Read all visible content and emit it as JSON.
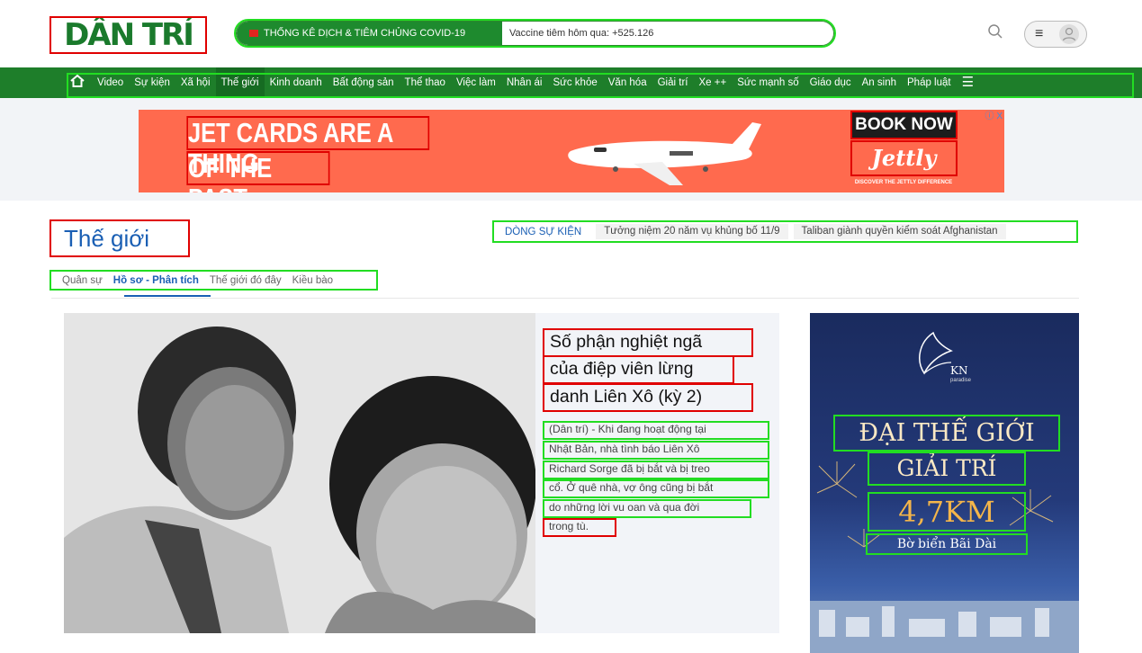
{
  "header": {
    "logo_text": "DÂN TRÍ",
    "covid_label": "THỐNG KÊ DỊCH & TIÊM CHỦNG COVID-19",
    "covid_stat": "Vaccine tiêm hôm qua: +525.126",
    "search_icon": "search-icon",
    "menu_icon": "hamburger-icon",
    "user_icon": "user-icon"
  },
  "nav": {
    "home_icon": "home-icon",
    "items": [
      "Video",
      "Sự kiện",
      "Xã hội",
      "Thế giới",
      "Kinh doanh",
      "Bất động sản",
      "Thể thao",
      "Việc làm",
      "Nhân ái",
      "Sức khỏe",
      "Văn hóa",
      "Giải trí",
      "Xe ++",
      "Sức mạnh số",
      "Giáo dục",
      "An sinh",
      "Pháp luật"
    ],
    "active": "Thế giới",
    "more_icon": "menu-icon"
  },
  "ad_banner": {
    "line1": "JET CARDS ARE A THING",
    "line2": "OF THE PAST",
    "cta": "BOOK NOW",
    "brand": "Jettly",
    "tagline": "DISCOVER THE JETTLY DIFFERENCE",
    "adchoices": "ⓘ X"
  },
  "section": {
    "title": "Thế giới",
    "events_label": "DÒNG SỰ KIỆN",
    "events": [
      "Tưởng niệm 20 năm vụ khủng bố 11/9",
      "Taliban giành quyền kiểm soát Afghanistan"
    ],
    "subnav": [
      "Quân sự",
      "Hồ sơ - Phân tích",
      "Thế giới đó đây",
      "Kiều bào"
    ],
    "subnav_active": "Hồ sơ - Phân tích"
  },
  "featured": {
    "title_lines": [
      "Số phận nghiệt ngã",
      "của điệp viên lừng",
      "danh Liên Xô (kỳ 2)"
    ],
    "summary_lines": [
      "(Dân trí) - Khi đang hoạt động tại",
      "Nhật Bản, nhà tình báo Liên Xô",
      "Richard Sorge đã bị bắt và bị treo",
      "cổ. Ở quê nhà, vợ ông cũng bị bắt",
      "do những lời vu oan và qua đời",
      "trong tù."
    ]
  },
  "side_ad": {
    "brand": "KN",
    "brand_sub": "paradise",
    "line1": "ĐẠI THẾ GIỚI",
    "line2": "GIẢI TRÍ",
    "line3": "4,7KM",
    "line4": "Bờ biển Bãi Dài"
  },
  "colors": {
    "brand_green": "#1e7e2a",
    "link_blue": "#1a5fb4",
    "ad_orange": "#ff6a4e",
    "box_red": "#e00000",
    "box_green": "#22dd22"
  }
}
